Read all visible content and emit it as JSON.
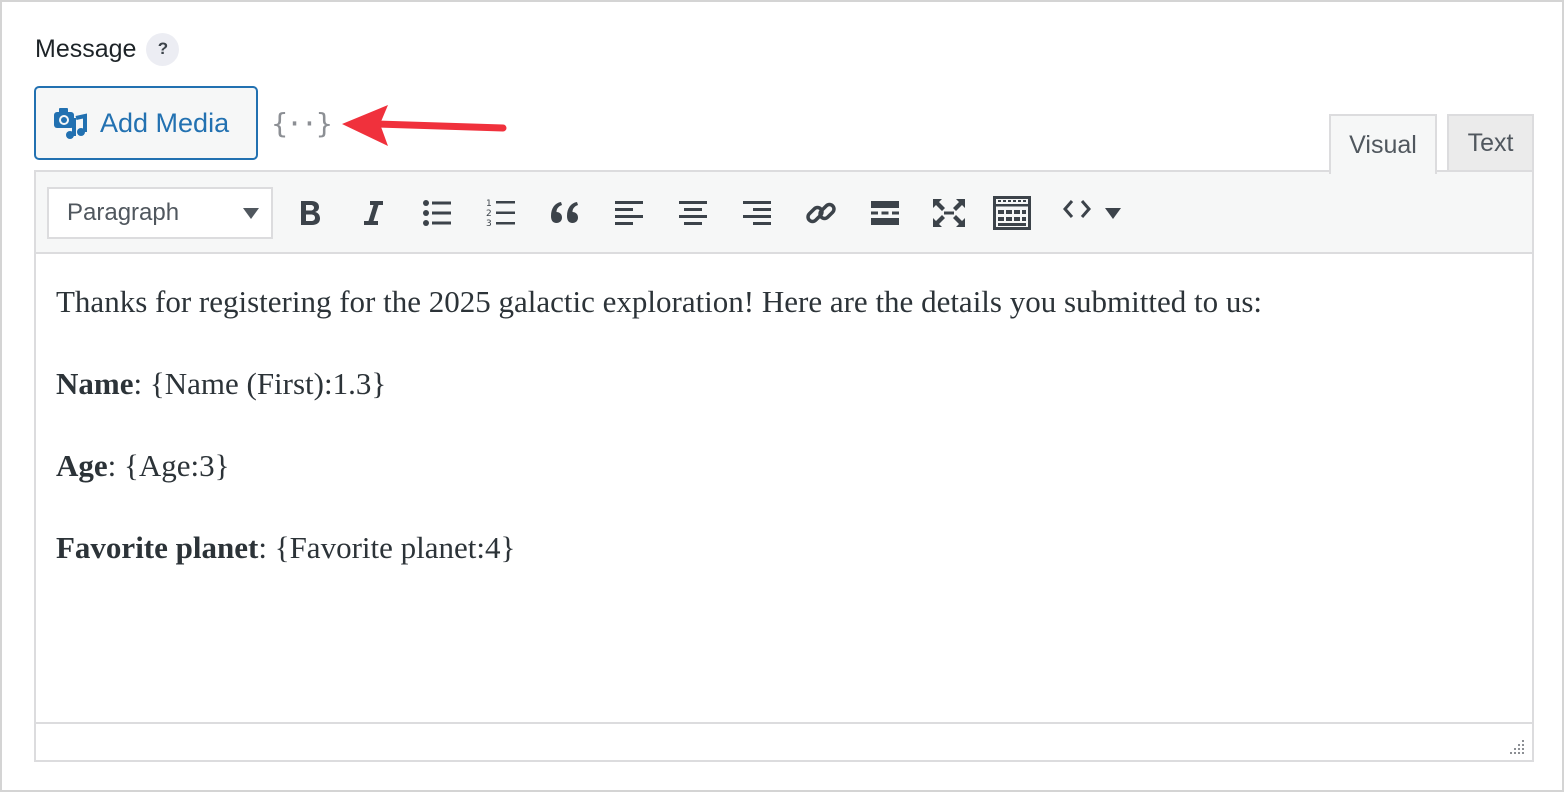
{
  "field": {
    "label": "Message",
    "help_symbol": "?"
  },
  "toolbar_top": {
    "add_media_label": "Add Media",
    "add_media_icon": "media-icon",
    "merge_tags_symbol": "{··}",
    "merge_tags_icon": "merge-tags-icon"
  },
  "tabs": [
    {
      "label": "Visual",
      "active": true
    },
    {
      "label": "Text",
      "active": false
    }
  ],
  "editor_toolbar": {
    "format_select_value": "Paragraph",
    "buttons": [
      "bold-icon",
      "italic-icon",
      "bullet-list-icon",
      "numbered-list-icon",
      "blockquote-icon",
      "align-left-icon",
      "align-center-icon",
      "align-right-icon",
      "link-icon",
      "read-more-icon",
      "fullscreen-icon",
      "toolbar-toggle-icon",
      "code-icon",
      "dropdown-caret-icon"
    ]
  },
  "content": {
    "intro": "Thanks for registering for the 2025 galactic exploration! Here are the details you submitted to us:",
    "lines": [
      {
        "label": "Name",
        "value": ": {Name (First):1.3}"
      },
      {
        "label": "Age",
        "value": ": {Age:3}"
      },
      {
        "label": "Favorite planet",
        "value": ": {Favorite planet:4}"
      }
    ]
  },
  "colors": {
    "accent": "#2271b1",
    "annotation_arrow": "#f0313c",
    "border": "#dcdcde",
    "toolbar_bg": "#f6f7f7"
  }
}
